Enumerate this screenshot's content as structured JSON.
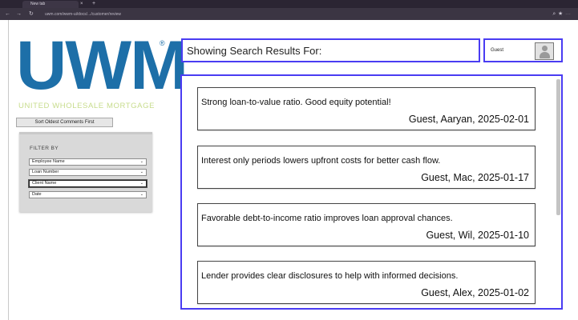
{
  "browser": {
    "tab_title": "New tab",
    "tab_close": "×",
    "tab_new": "+",
    "url": "uwm.com/wwm-ui/docs/.../customer/review"
  },
  "logo": {
    "text": "UWM",
    "registered": "®",
    "tagline": "UNITED WHOLESALE MORTGAGE"
  },
  "sidebar": {
    "sort_button": "Sort Oldest Comments First",
    "filter_title": "FILTER BY",
    "filters": [
      {
        "label": "Employee Name"
      },
      {
        "label": "Loan Number"
      },
      {
        "label": "Client Name"
      },
      {
        "label": "Date"
      }
    ]
  },
  "header": {
    "results_title": "Showing Search Results For:",
    "user_name": "Guest"
  },
  "results": [
    {
      "comment": "Strong loan-to-value ratio. Good equity potential!",
      "meta": "Guest, Aaryan, 2025-02-01"
    },
    {
      "comment": "Interest only periods lowers upfront costs for better cash flow.",
      "meta": "Guest, Mac, 2025-01-17"
    },
    {
      "comment": "Favorable debt-to-income ratio improves loan approval chances.",
      "meta": "Guest, Wil, 2025-01-10"
    },
    {
      "comment": "Lender provides clear disclosures to help with informed decisions.",
      "meta": "Guest, Alex, 2025-01-02"
    }
  ],
  "colors": {
    "brand_blue": "#1d6fa8",
    "tagline_green": "#c7dc8c",
    "accent_border": "#4a3cf2"
  }
}
